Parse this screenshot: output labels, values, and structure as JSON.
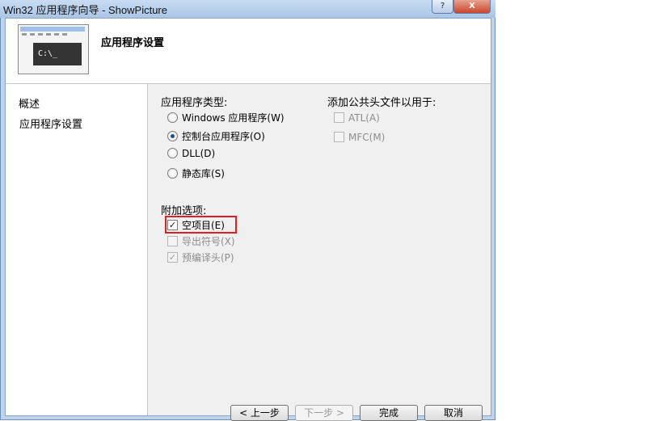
{
  "window": {
    "title": "Win32 应用程序向导 - ShowPicture",
    "help_glyph": "?",
    "close_glyph": "X"
  },
  "header": {
    "title": "应用程序设置",
    "thumbnail_console_text": "C:\\_"
  },
  "nav": {
    "items": [
      {
        "label": "概述"
      },
      {
        "label": "应用程序设置"
      }
    ]
  },
  "app_type": {
    "label": "应用程序类型:",
    "options": [
      {
        "label": "Windows 应用程序(W)",
        "selected": false
      },
      {
        "label": "控制台应用程序(O)",
        "selected": true
      },
      {
        "label": "DLL(D)",
        "selected": false
      },
      {
        "label": "静态库(S)",
        "selected": false
      }
    ]
  },
  "additional": {
    "label": "附加选项:",
    "options": [
      {
        "label": "空项目(E)",
        "checked": true,
        "enabled": true
      },
      {
        "label": "导出符号(X)",
        "checked": false,
        "enabled": false
      },
      {
        "label": "预编译头(P)",
        "checked": true,
        "enabled": false
      }
    ]
  },
  "common_headers": {
    "label": "添加公共头文件以用于:",
    "options": [
      {
        "label": "ATL(A)",
        "checked": false,
        "enabled": false
      },
      {
        "label": "MFC(M)",
        "checked": false,
        "enabled": false
      }
    ]
  },
  "buttons": {
    "prev": "< 上一步",
    "next": "下一步 >",
    "finish": "完成",
    "cancel": "取消"
  },
  "check_glyph": "✓"
}
